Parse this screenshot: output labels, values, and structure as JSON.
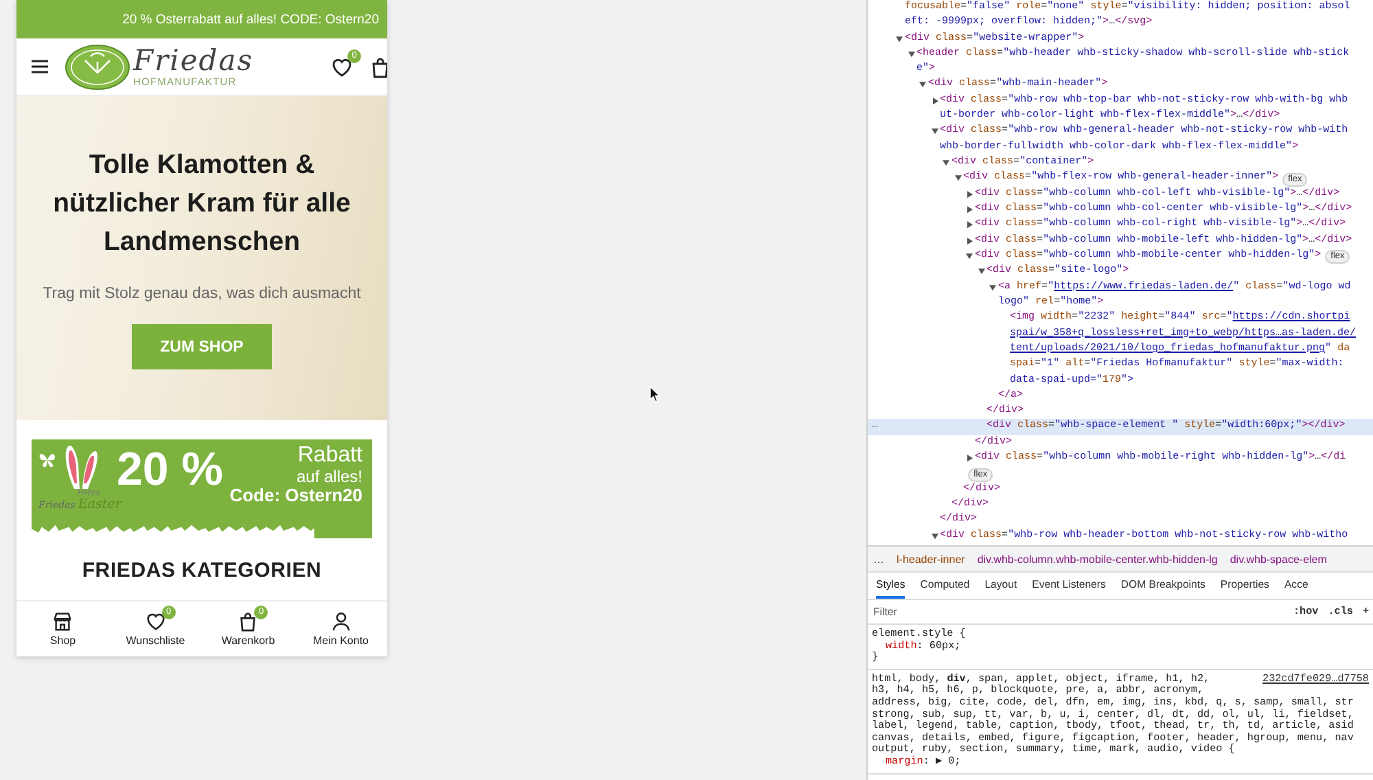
{
  "promo_bar": {
    "text": "20 % Osterrabatt auf alles! CODE: Ostern20"
  },
  "header": {
    "logo_name": "Friedas",
    "logo_subtitle": "HOFMANUFAKTUR",
    "wishlist_count": "0"
  },
  "hero": {
    "title": "Tolle Klamotten & nützlicher Kram für alle Landmenschen",
    "subtitle": "Trag mit Stolz genau das, was dich ausmacht",
    "button": "ZUM SHOP"
  },
  "easter_banner": {
    "percent": "20 %",
    "line_1": "Rabatt",
    "line_2": "auf alles!",
    "code": "Code: Ostern20",
    "signature": "Friedas",
    "greeting_small": "Happy",
    "greeting": "Easter"
  },
  "section_heading": "FRIEDAS KATEGORIEN",
  "bottom_nav": [
    {
      "kind": "shop",
      "label": "Shop"
    },
    {
      "kind": "wishlist",
      "label": "Wunschliste",
      "badge": "0"
    },
    {
      "kind": "cart",
      "label": "Warenkorb",
      "badge": "0"
    },
    {
      "kind": "account",
      "label": "Mein Konto"
    }
  ],
  "devtools": {
    "dom_tree": [
      {
        "lines": [
          "focusable=\"false\" role=\"none\" style=\"visibility: hidden; position: absol",
          "eft: -9999px; overflow: hidden;\">…</svg>"
        ],
        "selected": false
      },
      {
        "lines": [
          "<div class=\"website-wrapper\">"
        ],
        "expanded": true,
        "selected": false,
        "children": [
          {
            "lines": [
              "<header class=\"whb-header whb-sticky-shadow whb-scroll-slide whb-stick",
              "e\">"
            ],
            "expanded": true,
            "selected": false,
            "children": [
              {
                "lines": [
                  "<div class=\"whb-main-header\">"
                ],
                "expanded": true,
                "selected": false,
                "children": [
                  {
                    "lines": [
                      "<div class=\"whb-row whb-top-bar whb-not-sticky-row whb-with-bg whb",
                      "ut-border whb-color-light whb-flex-flex-middle\">…</div>"
                    ],
                    "expanded": false,
                    "selected": false
                  },
                  {
                    "lines": [
                      "<div class=\"whb-row whb-general-header whb-not-sticky-row whb-with",
                      "whb-border-fullwidth whb-color-dark whb-flex-flex-middle\">"
                    ],
                    "expanded": true,
                    "selected": false,
                    "close": "</div>",
                    "children": [
                      {
                        "lines": [
                          "<div class=\"container\">"
                        ],
                        "expanded": true,
                        "selected": false,
                        "close": "</div>",
                        "children": [
                          {
                            "lines": [
                              "<div class=\"whb-flex-row whb-general-header-inner\">"
                            ],
                            "badge": "flex",
                            "expanded": true,
                            "selected": false,
                            "close": "</div>",
                            "children": [
                              {
                                "lines": [
                                  "<div class=\"whb-column whb-col-left whb-visible-lg\">…</div>"
                                ],
                                "expanded": false,
                                "selected": false
                              },
                              {
                                "lines": [
                                  "<div class=\"whb-column whb-col-center whb-visible-lg\">…</div>"
                                ],
                                "expanded": false,
                                "selected": false
                              },
                              {
                                "lines": [
                                  "<div class=\"whb-column whb-col-right whb-visible-lg\">…</div>"
                                ],
                                "expanded": false,
                                "selected": false
                              },
                              {
                                "lines": [
                                  "<div class=\"whb-column whb-mobile-left whb-hidden-lg\">…</div>"
                                ],
                                "expanded": false,
                                "selected": false
                              },
                              {
                                "lines": [
                                  "<div class=\"whb-column whb-mobile-center whb-hidden-lg\">"
                                ],
                                "badge": "flex",
                                "expanded": true,
                                "selected": false,
                                "close": "</div>",
                                "children": [
                                  {
                                    "lines": [
                                      "<div class=\"site-logo\">"
                                    ],
                                    "expanded": true,
                                    "selected": false,
                                    "close": "</div>",
                                    "children": [
                                      {
                                        "lines": [
                                          "<a href=\"https://www.friedas-laden.de/\" class=\"wd-logo wd",
                                          "logo\" rel=\"home\">"
                                        ],
                                        "expanded": true,
                                        "selected": false,
                                        "close": "</a>",
                                        "children": [
                                          {
                                            "lines": [
                                              "<img width=\"2232\" height=\"844\" src=\"https://cdn.shortpi",
                                              "spai/w_358+q_lossless+ret_img+to_webp/https…as-laden.de/",
                                              "tent/uploads/2021/10/logo_friedas_hofmanufaktur.png\" da",
                                              "spai=\"1\" alt=\"Friedas Hofmanufaktur\" style=\"max-width:",
                                              "data-spai-upd=\"179\">"
                                            ],
                                            "selected": false
                                          }
                                        ]
                                      }
                                    ]
                                  },
                                  {
                                    "lines": [
                                      "<div class=\"whb-space-element \" style=\"width:60px;\"></div>"
                                    ],
                                    "selected": true,
                                    "gutter": "…"
                                  }
                                ]
                              },
                              {
                                "lines": [
                                  "<div class=\"whb-column whb-mobile-right whb-hidden-lg\">…</di"
                                ],
                                "badge": "flex",
                                "expanded": false,
                                "selected": false
                              }
                            ]
                          }
                        ]
                      }
                    ]
                  },
                  {
                    "lines": [
                      "<div class=\"whb-row whb-header-bottom whb-not-sticky-row whb-witho"
                    ],
                    "expanded": true,
                    "selected": false
                  }
                ]
              }
            ]
          }
        ]
      }
    ],
    "breadcrumbs": {
      "overflow_button": "…",
      "items": [
        "l-header-inner",
        "div.whb-column.whb-mobile-center.whb-hidden-lg",
        "div.whb-space-elem"
      ]
    },
    "tabs": [
      {
        "label": "Styles",
        "selected": true
      },
      {
        "label": "Computed",
        "selected": false
      },
      {
        "label": "Layout",
        "selected": false
      },
      {
        "label": "Event Listeners",
        "selected": false
      },
      {
        "label": "DOM Breakpoints",
        "selected": false
      },
      {
        "label": "Properties",
        "selected": false
      },
      {
        "label": "Acce",
        "selected": false
      }
    ],
    "filter": {
      "placeholder": "Filter",
      "buttons": [
        ":hov",
        ".cls",
        "+"
      ]
    },
    "style_rules": [
      {
        "selector_lines": [
          "element.style {"
        ],
        "declarations": [
          "width: 60px;"
        ],
        "closing": "}"
      },
      {
        "selector_lines": [
          "html, body, **div**, span, applet, object, iframe, h1, h2,",
          "h3, h4, h5, h6, p, blockquote, pre, a, abbr, acronym,",
          "address, big, cite, code, del, dfn, em, img, ins, kbd, q, s, samp, small, str",
          "strong, sub, sup, tt, var, b, u, i, center, dl, dt, dd, ol, ul, li, fieldset,",
          "label, legend, table, caption, tbody, tfoot, thead, tr, th, td, article, asid",
          "canvas, details, embed, figure, figcaption, footer, header, hgroup, menu, nav",
          "output, ruby, section, summary, time, mark, audio, video {"
        ],
        "source": "232cd7fe029…d7758",
        "declarations": [
          "margin: ▶ 0;"
        ]
      }
    ]
  }
}
